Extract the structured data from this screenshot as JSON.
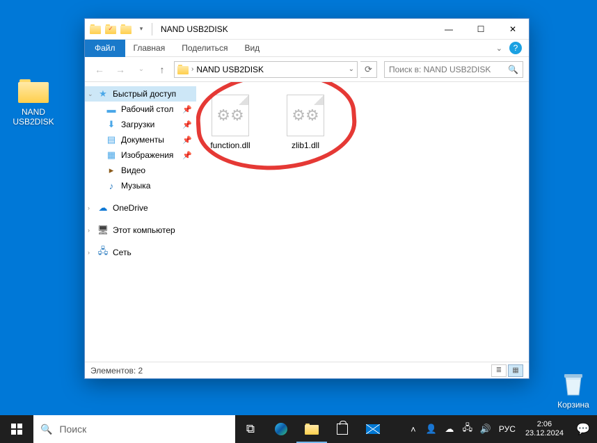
{
  "desktop": {
    "folder_name": "NAND USB2DISK",
    "recycle_name": "Корзина"
  },
  "window": {
    "title": "NAND USB2DISK",
    "tabs": {
      "file": "Файл",
      "home": "Главная",
      "share": "Поделиться",
      "view": "Вид"
    },
    "breadcrumb": "NAND USB2DISK",
    "search_placeholder": "Поиск в: NAND USB2DISK",
    "sidebar": {
      "quick_access": "Быстрый доступ",
      "desktop": "Рабочий стол",
      "downloads": "Загрузки",
      "documents": "Документы",
      "pictures": "Изображения",
      "videos": "Видео",
      "music": "Музыка",
      "onedrive": "OneDrive",
      "this_pc": "Этот компьютер",
      "network": "Сеть"
    },
    "files": [
      {
        "name": "function.dll"
      },
      {
        "name": "zlib1.dll"
      }
    ],
    "status": "Элементов: 2"
  },
  "taskbar": {
    "search_placeholder": "Поиск",
    "lang": "РУС",
    "time": "2:06",
    "date": "23.12.2024"
  }
}
